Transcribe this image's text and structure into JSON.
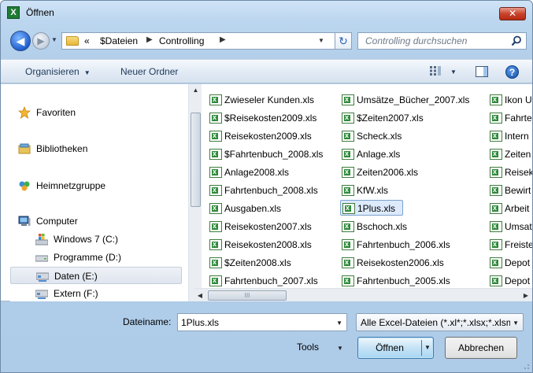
{
  "window": {
    "title": "Öffnen",
    "close_label": "✕",
    "app_icon_letter": "X"
  },
  "nav": {
    "back_label": "◀",
    "forward_label": "▶",
    "history_caret": "▼",
    "breadcrumb": {
      "overflow": "«",
      "crumb1": "$Dateien",
      "sep": "▶",
      "crumb2": "Controlling",
      "sep2": "▶"
    },
    "address_caret": "▼",
    "refresh_label": "↻",
    "search_placeholder": "Controlling durchsuchen"
  },
  "toolbar": {
    "organize_label": "Organisieren",
    "organize_caret": "▼",
    "new_folder_label": "Neuer Ordner",
    "views_caret": "▼",
    "help_label": "?"
  },
  "sidebar": {
    "items": [
      {
        "label": "Favoriten",
        "icon": "star-icon"
      },
      {
        "label": "Bibliotheken",
        "icon": "library-icon"
      },
      {
        "label": "Heimnetzgruppe",
        "icon": "homegroup-icon"
      },
      {
        "label": "Computer",
        "icon": "computer-icon"
      },
      {
        "label": "Windows 7 (C:)",
        "icon": "windows-drive-icon"
      },
      {
        "label": "Programme (D:)",
        "icon": "drive-icon"
      },
      {
        "label": "Daten (E:)",
        "icon": "network-drive-icon"
      },
      {
        "label": "Extern (F:)",
        "icon": "network-drive-icon"
      }
    ],
    "selected": "Daten (E:)"
  },
  "files": {
    "columns": [
      [
        "Zwieseler Kunden.xls",
        "$Reisekosten2009.xls",
        "Reisekosten2009.xls",
        "$Fahrtenbuch_2008.xls",
        "Anlage2008.xls",
        "Fahrtenbuch_2008.xls",
        "Ausgaben.xls",
        "Reisekosten2007.xls",
        "Reisekosten2008.xls",
        "$Zeiten2008.xls",
        "Fahrtenbuch_2007.xls"
      ],
      [
        "Umsätze_Bücher_2007.xls",
        "$Zeiten2007.xls",
        "Scheck.xls",
        "Anlage.xls",
        "Zeiten2006.xls",
        "KfW.xls",
        "1Plus.xls",
        "Bschoch.xls",
        "Fahrtenbuch_2006.xls",
        "Reisekosten2006.xls",
        "Fahrtenbuch_2005.xls"
      ],
      [
        "Ikon U",
        "Fahrte",
        "Intern",
        "Zeiten",
        "Reisek",
        "Bewirt",
        "Arbeit",
        "Umsat",
        "Freiste",
        "Depot",
        "Depot"
      ]
    ],
    "selected": "1Plus.xls"
  },
  "bottom": {
    "filename_label": "Dateiname:",
    "filename_value": "1Plus.xls",
    "filename_caret": "▼",
    "filetype_value": "Alle Excel-Dateien (*.xl*;*.xlsx;*.xlsm",
    "filetype_caret": "▼",
    "tools_label": "Tools",
    "tools_caret": "▼",
    "open_label": "Öffnen",
    "open_caret": "▼",
    "cancel_label": "Abbrechen"
  },
  "scroll": {
    "up": "▲",
    "down": "▼",
    "left": "◀",
    "right": "▶",
    "grip": "III"
  },
  "colors": {
    "accent": "#3d7bad",
    "selection": "#dceafc",
    "title_close": "#c9432c"
  }
}
